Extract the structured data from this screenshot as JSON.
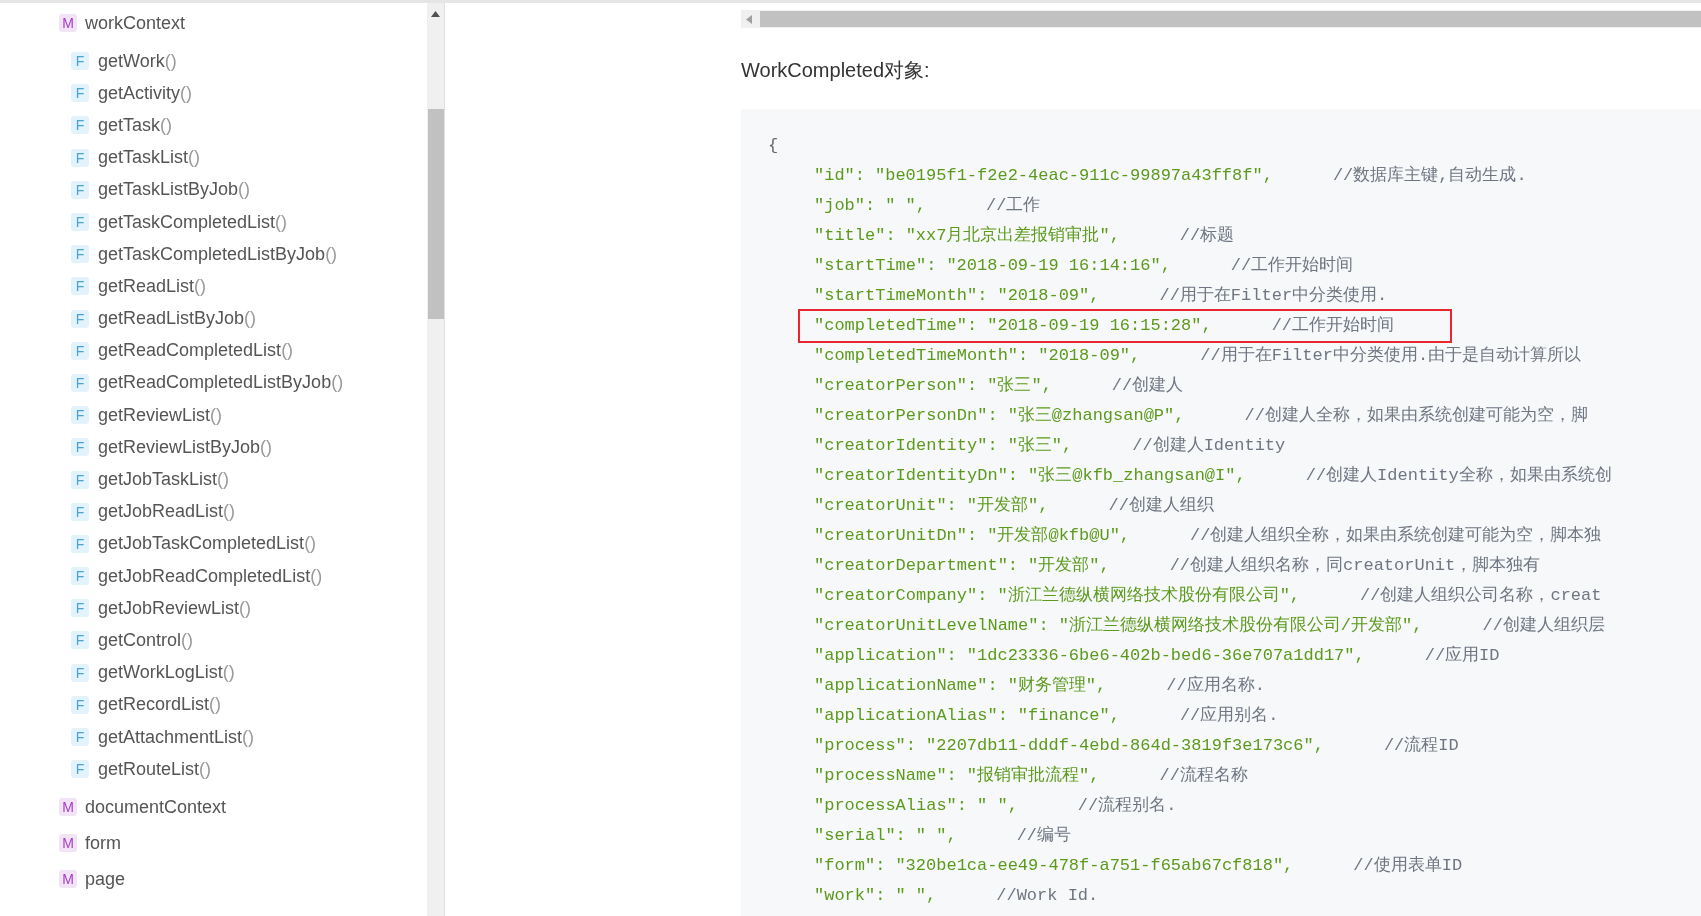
{
  "sidebar": {
    "items": [
      {
        "kind": "module",
        "badge": "M",
        "label": "workContext",
        "children": [
          {
            "kind": "function",
            "badge": "F",
            "name": "getWork",
            "parens": "()"
          },
          {
            "kind": "function",
            "badge": "F",
            "name": "getActivity",
            "parens": "()"
          },
          {
            "kind": "function",
            "badge": "F",
            "name": "getTask",
            "parens": "()"
          },
          {
            "kind": "function",
            "badge": "F",
            "name": "getTaskList",
            "parens": "()"
          },
          {
            "kind": "function",
            "badge": "F",
            "name": "getTaskListByJob",
            "parens": "()"
          },
          {
            "kind": "function",
            "badge": "F",
            "name": "getTaskCompletedList",
            "parens": "()"
          },
          {
            "kind": "function",
            "badge": "F",
            "name": "getTaskCompletedListByJob",
            "parens": "()"
          },
          {
            "kind": "function",
            "badge": "F",
            "name": "getReadList",
            "parens": "()"
          },
          {
            "kind": "function",
            "badge": "F",
            "name": "getReadListByJob",
            "parens": "()"
          },
          {
            "kind": "function",
            "badge": "F",
            "name": "getReadCompletedList",
            "parens": "()"
          },
          {
            "kind": "function",
            "badge": "F",
            "name": "getReadCompletedListByJob",
            "parens": "()"
          },
          {
            "kind": "function",
            "badge": "F",
            "name": "getReviewList",
            "parens": "()"
          },
          {
            "kind": "function",
            "badge": "F",
            "name": "getReviewListByJob",
            "parens": "()"
          },
          {
            "kind": "function",
            "badge": "F",
            "name": "getJobTaskList",
            "parens": "()"
          },
          {
            "kind": "function",
            "badge": "F",
            "name": "getJobReadList",
            "parens": "()"
          },
          {
            "kind": "function",
            "badge": "F",
            "name": "getJobTaskCompletedList",
            "parens": "()"
          },
          {
            "kind": "function",
            "badge": "F",
            "name": "getJobReadCompletedList",
            "parens": "()"
          },
          {
            "kind": "function",
            "badge": "F",
            "name": "getJobReviewList",
            "parens": "()"
          },
          {
            "kind": "function",
            "badge": "F",
            "name": "getControl",
            "parens": "()"
          },
          {
            "kind": "function",
            "badge": "F",
            "name": "getWorkLogList",
            "parens": "()"
          },
          {
            "kind": "function",
            "badge": "F",
            "name": "getRecordList",
            "parens": "()"
          },
          {
            "kind": "function",
            "badge": "F",
            "name": "getAttachmentList",
            "parens": "()"
          },
          {
            "kind": "function",
            "badge": "F",
            "name": "getRouteList",
            "parens": "()"
          }
        ]
      },
      {
        "kind": "module",
        "badge": "M",
        "label": "documentContext"
      },
      {
        "kind": "module",
        "badge": "M",
        "label": "form"
      },
      {
        "kind": "module",
        "badge": "M",
        "label": "page"
      }
    ]
  },
  "content": {
    "heading": "WorkCompleted对象:",
    "code": {
      "open": "{",
      "lines": [
        {
          "key": "\"id\":",
          "value": "\"be0195f1-f2e2-4eac-911c-99897a43ff8f\",",
          "comment": "//数据库主键,自动生成.",
          "highlighted": false
        },
        {
          "key": "\"job\":",
          "value": "\" \",",
          "comment": "//工作",
          "highlighted": false
        },
        {
          "key": "\"title\":",
          "value": "\"xx7月北京出差报销审批\",",
          "comment": "//标题",
          "highlighted": false
        },
        {
          "key": "\"startTime\":",
          "value": "\"2018-09-19 16:14:16\",",
          "comment": "//工作开始时间",
          "highlighted": false
        },
        {
          "key": "\"startTimeMonth\":",
          "value": "\"2018-09\",",
          "comment": "//用于在Filter中分类使用.",
          "highlighted": false
        },
        {
          "key": "\"completedTime\":",
          "value": "\"2018-09-19 16:15:28\",",
          "comment": "//工作开始时间",
          "highlighted": true
        },
        {
          "key": "\"completedTimeMonth\":",
          "value": "\"2018-09\",",
          "comment": "//用于在Filter中分类使用.由于是自动计算所以",
          "highlighted": false
        },
        {
          "key": "\"creatorPerson\":",
          "value": "\"张三\",",
          "comment": "//创建人",
          "highlighted": false
        },
        {
          "key": "\"creatorPersonDn\":",
          "value": "\"张三@zhangsan@P\",",
          "comment": "//创建人全称，如果由系统创建可能为空，脚",
          "highlighted": false
        },
        {
          "key": "\"creatorIdentity\":",
          "value": "\"张三\",",
          "comment": "//创建人Identity",
          "highlighted": false
        },
        {
          "key": "\"creatorIdentityDn\":",
          "value": "\"张三@kfb_zhangsan@I\",",
          "comment": "//创建人Identity全称，如果由系统创",
          "highlighted": false
        },
        {
          "key": "\"creatorUnit\":",
          "value": "\"开发部\",",
          "comment": "//创建人组织",
          "highlighted": false
        },
        {
          "key": "\"creatorUnitDn\":",
          "value": "\"开发部@kfb@U\",",
          "comment": "//创建人组织全称，如果由系统创建可能为空，脚本独",
          "highlighted": false
        },
        {
          "key": "\"creatorDepartment\":",
          "value": "\"开发部\",",
          "comment": "//创建人组织名称，同creatorUnit，脚本独有",
          "highlighted": false
        },
        {
          "key": "\"creatorCompany\":",
          "value": "\"浙江兰德纵横网络技术股份有限公司\",",
          "comment": "//创建人组织公司名称，creat",
          "highlighted": false
        },
        {
          "key": "\"creatorUnitLevelName\":",
          "value": "\"浙江兰德纵横网络技术股份有限公司/开发部\",",
          "comment": "//创建人组织层",
          "highlighted": false
        },
        {
          "key": "\"application\":",
          "value": "\"1dc23336-6be6-402b-bed6-36e707a1dd17\",",
          "comment": "//应用ID",
          "highlighted": false
        },
        {
          "key": "\"applicationName\":",
          "value": "\"财务管理\",",
          "comment": "//应用名称.",
          "highlighted": false
        },
        {
          "key": "\"applicationAlias\":",
          "value": "\"finance\",",
          "comment": "//应用别名.",
          "highlighted": false
        },
        {
          "key": "\"process\":",
          "value": "\"2207db11-dddf-4ebd-864d-3819f3e173c6\",",
          "comment": "//流程ID",
          "highlighted": false
        },
        {
          "key": "\"processName\":",
          "value": "\"报销审批流程\",",
          "comment": "//流程名称",
          "highlighted": false
        },
        {
          "key": "\"processAlias\":",
          "value": "\" \",",
          "comment": "//流程别名.",
          "highlighted": false
        },
        {
          "key": "\"serial\":",
          "value": "\" \",",
          "comment": "//编号",
          "highlighted": false
        },
        {
          "key": "\"form\":",
          "value": "\"320be1ca-ee49-478f-a751-f65ab67cf818\",",
          "comment": "//使用表单ID",
          "highlighted": false
        },
        {
          "key": "\"work\":",
          "value": "\" \",",
          "comment": "//Work Id.",
          "highlighted": false
        }
      ]
    }
  }
}
